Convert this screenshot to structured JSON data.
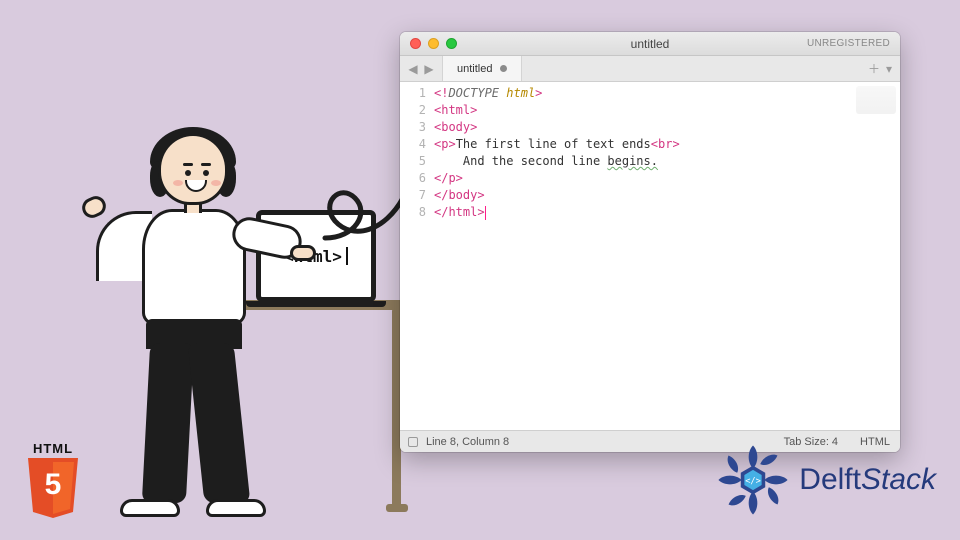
{
  "window": {
    "title": "untitled",
    "registration": "UNREGISTERED",
    "tab_label": "untitled",
    "nav_back": "◀",
    "nav_fwd": "▶",
    "add_tab": "＋",
    "more": "▾"
  },
  "code": {
    "line_numbers": [
      "1",
      "2",
      "3",
      "4",
      "5",
      "6",
      "7",
      "8"
    ],
    "l1_open": "<!",
    "l1_doctype": "DOCTYPE",
    "l1_kw": "html",
    "l1_close": ">",
    "l2": "<html>",
    "l3": "<body>",
    "l4_open": "<p>",
    "l4_text": "The first line of text ends",
    "l4_br": "<br>",
    "l5_text": "    And the second line ",
    "l5_word": "begins.",
    "l6": "</p>",
    "l7": "</body>",
    "l8": "</html>"
  },
  "statusbar": {
    "position": "Line 8, Column 8",
    "tab_size": "Tab Size: 4",
    "syntax": "HTML"
  },
  "laptop": {
    "text": "<html>"
  },
  "html5": {
    "label": "HTML",
    "five": "5"
  },
  "delft": {
    "brand_a": "Delft",
    "brand_b": "Stack"
  }
}
